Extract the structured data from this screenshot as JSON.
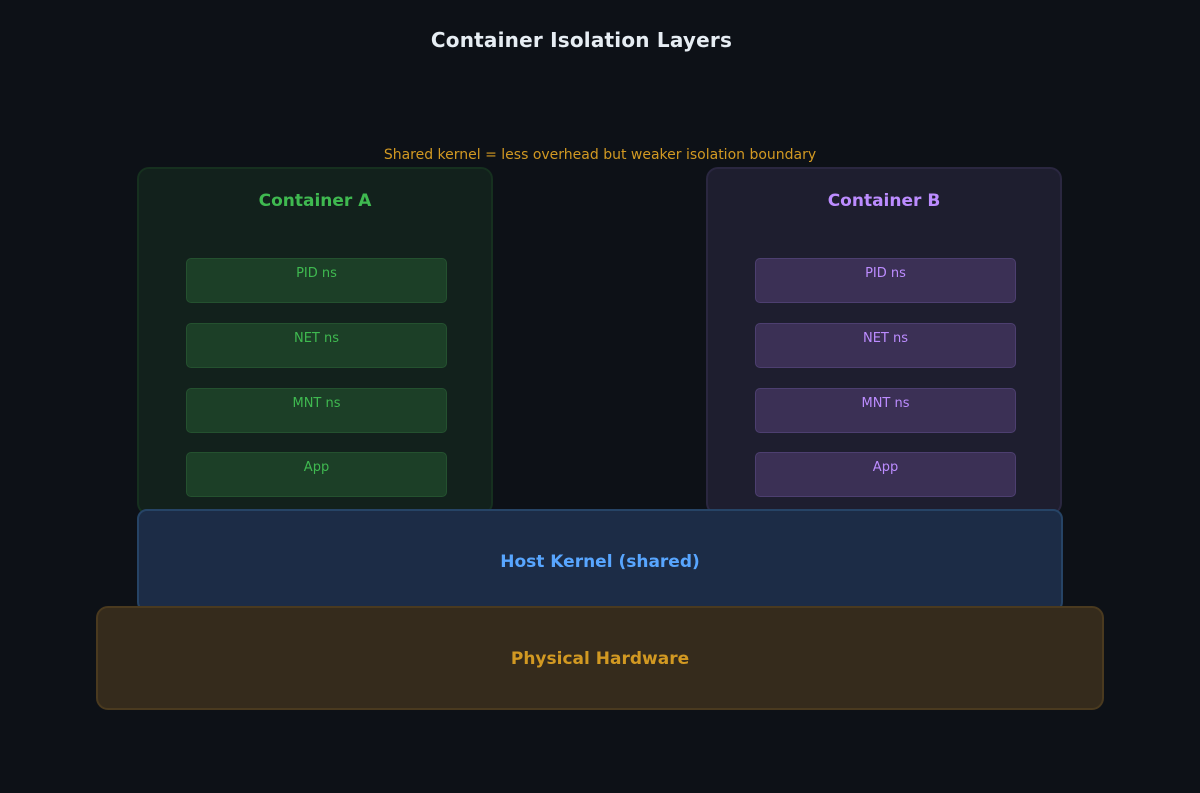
{
  "title": "Container Isolation Layers",
  "note": "Shared kernel = less overhead but weaker isolation boundary",
  "containers": [
    {
      "name": "Container A",
      "color": "#3fb950",
      "layers": [
        "PID ns",
        "NET ns",
        "MNT ns",
        "App"
      ]
    },
    {
      "name": "Container B",
      "color": "#bc8cff",
      "layers": [
        "PID ns",
        "NET ns",
        "MNT ns",
        "App"
      ]
    }
  ],
  "kernel": {
    "label": "Host Kernel (shared)",
    "color": "#58a6ff"
  },
  "hardware": {
    "label": "Physical Hardware",
    "color": "#d29922"
  }
}
